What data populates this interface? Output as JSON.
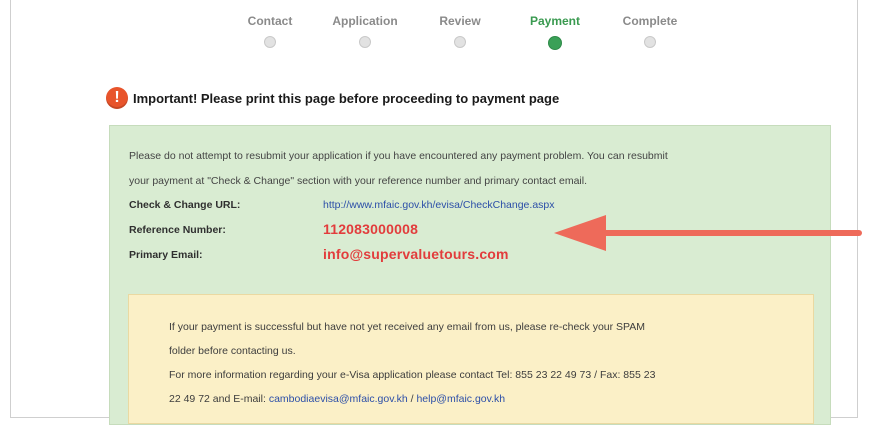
{
  "progress": {
    "steps": [
      {
        "label": "Contact",
        "state": "inactive"
      },
      {
        "label": "Application",
        "state": "inactive"
      },
      {
        "label": "Review",
        "state": "inactive"
      },
      {
        "label": "Payment",
        "state": "active"
      },
      {
        "label": "Complete",
        "state": "inactive"
      }
    ]
  },
  "notice": {
    "icon": "exclamation-icon",
    "text": "Important! Please print this page before proceeding to payment page"
  },
  "info": {
    "paragraph_line1": "Please do not attempt to resubmit your application if you have encountered any payment problem. You can resubmit",
    "paragraph_line2": "your payment at \"Check & Change\" section with your reference number and primary contact email.",
    "check_change_label": "Check & Change URL:",
    "check_change_url": "http://www.mfaic.gov.kh/evisa/CheckChange.aspx",
    "reference_label": "Reference Number:",
    "reference_value": "112083000008",
    "email_label": "Primary Email:",
    "email_value": "info@supervaluetours.com"
  },
  "contact_box": {
    "line1": "If your payment is successful but have not yet received any email from us, please re-check your SPAM",
    "line2": "folder before contacting us.",
    "line3": "For more information regarding your e-Visa application please contact Tel: 855 23 22 49 73 / Fax: 855 23",
    "line4_prefix": "22 49 72 and E-mail:",
    "email1": "cambodiaevisa@mfaic.gov.kh",
    "separator": " / ",
    "email2": "help@mfaic.gov.kh"
  },
  "colors": {
    "active_step": "#3a9a50",
    "warning": "#e8542b",
    "green_panel": "#d9ecd2",
    "yellow_panel": "#fbf0c7",
    "highlight_red": "#e23c3c",
    "arrow": "#ee6a5a"
  }
}
